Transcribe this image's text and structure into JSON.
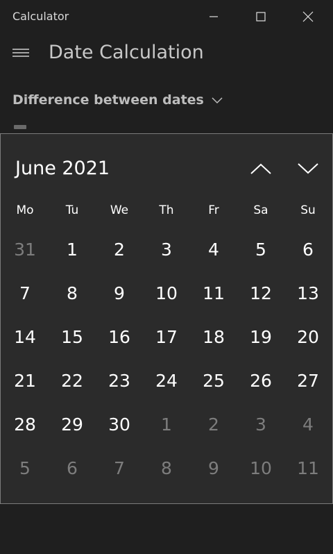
{
  "window": {
    "title": "Calculator"
  },
  "header": {
    "title": "Date Calculation"
  },
  "mode": {
    "selected": "Difference between dates"
  },
  "calendar": {
    "month_label": "June 2021",
    "weekdays": [
      "Mo",
      "Tu",
      "We",
      "Th",
      "Fr",
      "Sa",
      "Su"
    ],
    "weeks": [
      [
        {
          "d": "31",
          "out": true
        },
        {
          "d": "1"
        },
        {
          "d": "2"
        },
        {
          "d": "3"
        },
        {
          "d": "4"
        },
        {
          "d": "5"
        },
        {
          "d": "6"
        }
      ],
      [
        {
          "d": "7"
        },
        {
          "d": "8"
        },
        {
          "d": "9"
        },
        {
          "d": "10"
        },
        {
          "d": "11"
        },
        {
          "d": "12"
        },
        {
          "d": "13"
        }
      ],
      [
        {
          "d": "14"
        },
        {
          "d": "15"
        },
        {
          "d": "16"
        },
        {
          "d": "17"
        },
        {
          "d": "18"
        },
        {
          "d": "19"
        },
        {
          "d": "20"
        }
      ],
      [
        {
          "d": "21"
        },
        {
          "d": "22"
        },
        {
          "d": "23"
        },
        {
          "d": "24"
        },
        {
          "d": "25"
        },
        {
          "d": "26"
        },
        {
          "d": "27"
        }
      ],
      [
        {
          "d": "28"
        },
        {
          "d": "29"
        },
        {
          "d": "30"
        },
        {
          "d": "1",
          "out": true
        },
        {
          "d": "2",
          "out": true
        },
        {
          "d": "3",
          "out": true
        },
        {
          "d": "4",
          "out": true
        }
      ],
      [
        {
          "d": "5",
          "out": true
        },
        {
          "d": "6",
          "out": true
        },
        {
          "d": "7",
          "out": true
        },
        {
          "d": "8",
          "out": true
        },
        {
          "d": "9",
          "out": true
        },
        {
          "d": "10",
          "out": true
        },
        {
          "d": "11",
          "out": true
        }
      ]
    ]
  },
  "colors": {
    "background": "#1f1f1f",
    "calendar_bg": "#2b2b2b",
    "outside_day": "#7d7d7d"
  }
}
